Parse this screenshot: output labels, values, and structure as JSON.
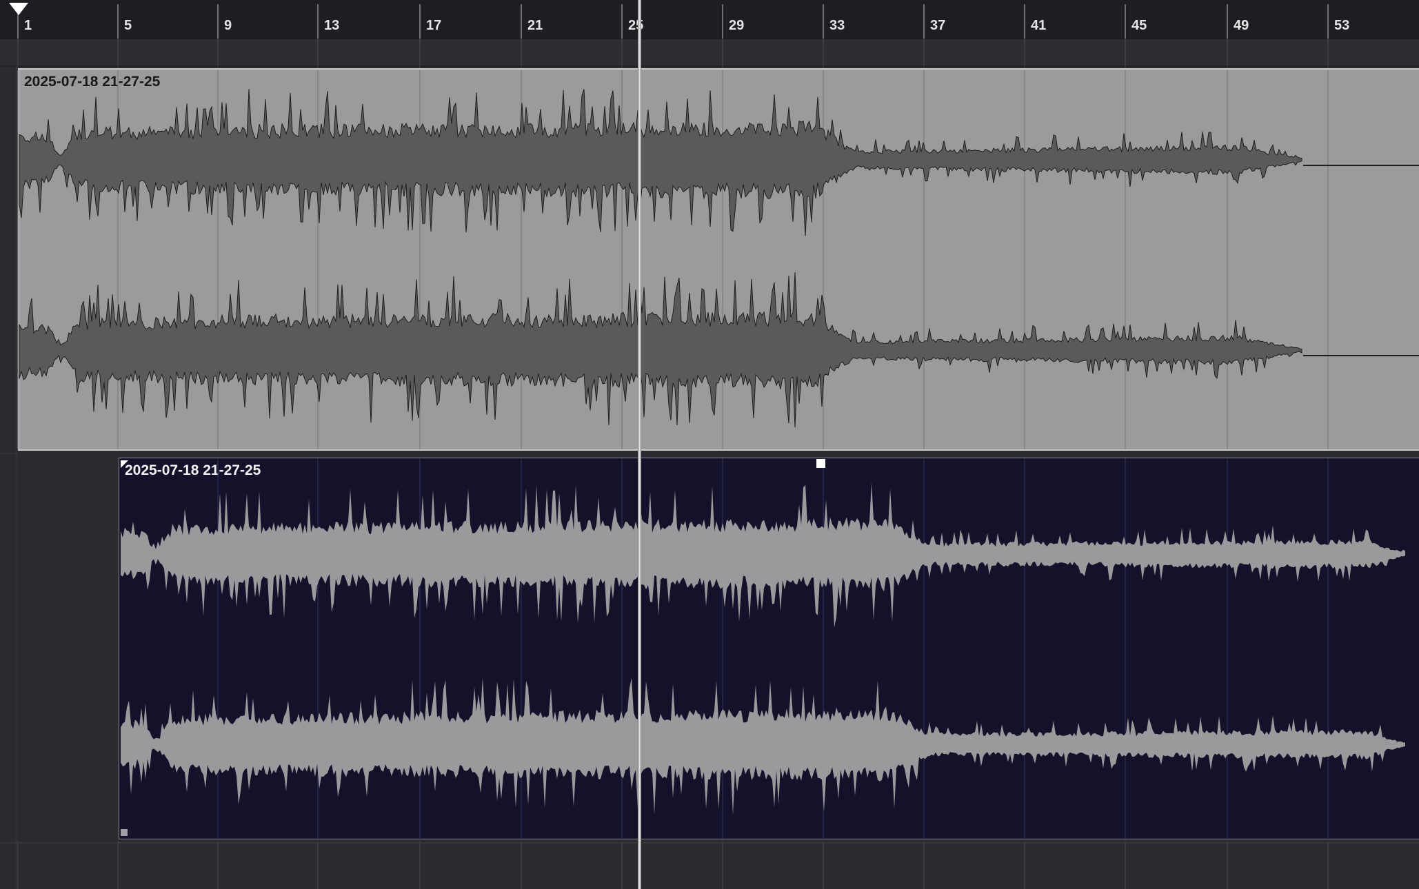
{
  "ruler": {
    "bars": [
      "1",
      "5",
      "9",
      "13",
      "17",
      "21",
      "25",
      "29",
      "33",
      "37",
      "41",
      "45",
      "49",
      "53"
    ]
  },
  "events": [
    {
      "title": "2025-07-18 21-27-25"
    },
    {
      "title": "2025-07-18 21-27-25"
    }
  ],
  "colors": {
    "event1_bg": "#9a9b9d",
    "event1_wave": "#5a5a5c",
    "event2_bg": "#13122a",
    "event2_wave": "#9a9a9c"
  },
  "icons": {
    "playhead": "triangle-down-icon",
    "fade_handle": "square-handle-icon"
  }
}
